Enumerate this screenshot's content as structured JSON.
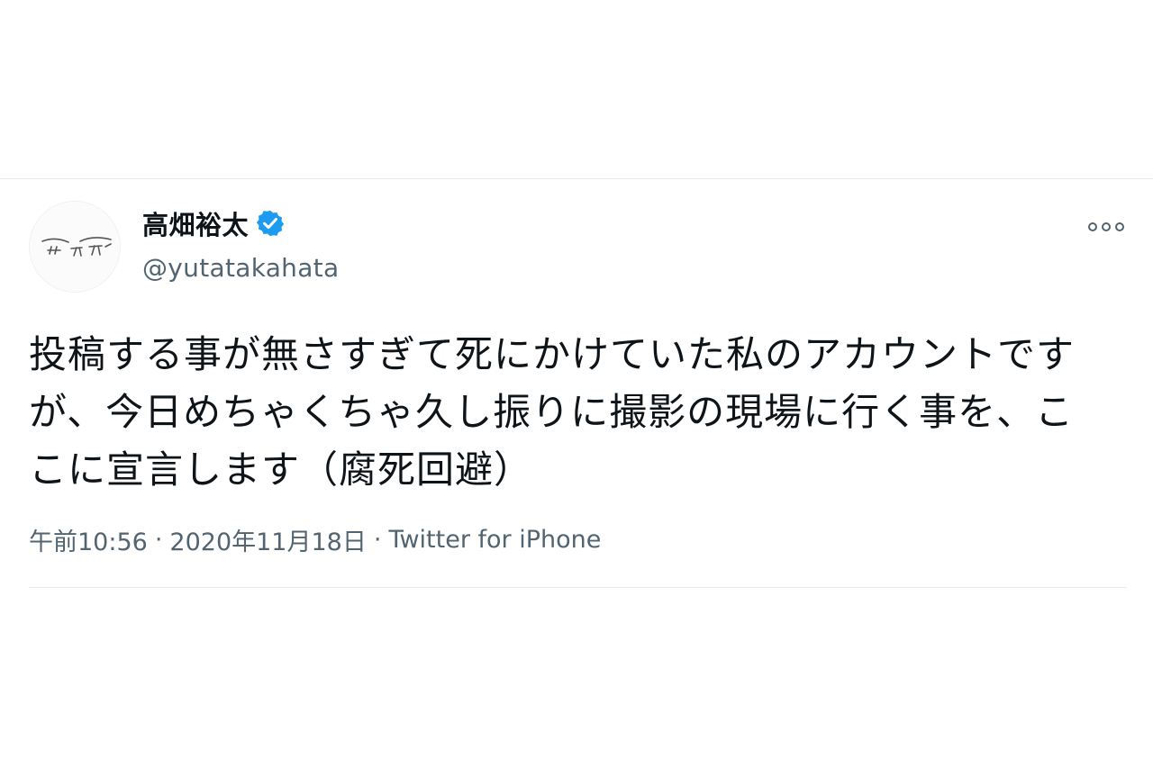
{
  "tweet": {
    "display_name": "高畑裕太",
    "handle": "@yutatakahata",
    "text": "投稿する事が無さすぎて死にかけていた私のアカウントですが、今日めちゃくちゃ久し振りに撮影の現場に行く事を、ここに宣言します（腐死回避）",
    "time": "午前10:56",
    "separator": "·",
    "date": "2020年11月18日",
    "source": "Twitter for iPhone"
  },
  "colors": {
    "verified": "#1d9bf0",
    "secondary_text": "#536471",
    "primary_text": "#0f1419",
    "divider": "#e6ecf0"
  },
  "icons": {
    "verified": "verified-badge-icon",
    "more": "more-options-icon"
  }
}
